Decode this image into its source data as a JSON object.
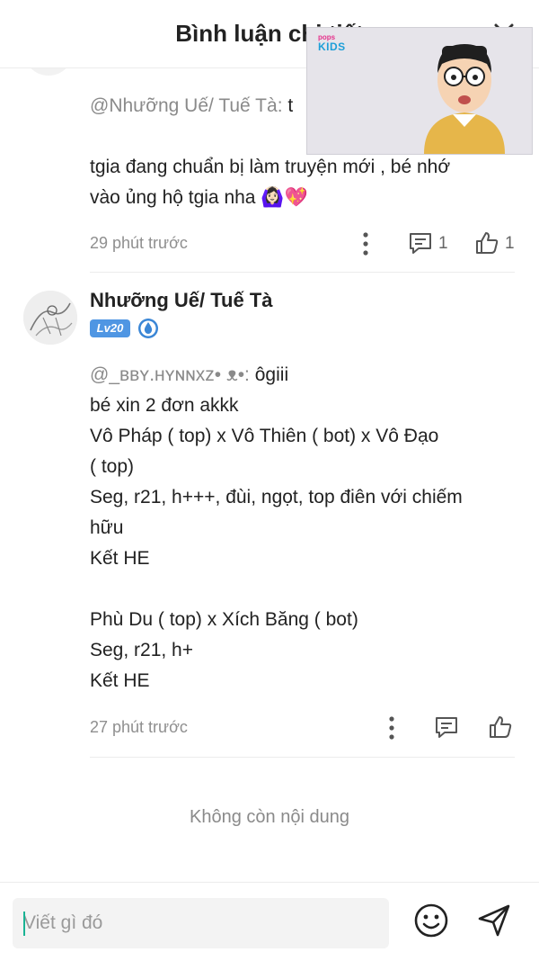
{
  "header": {
    "title": "Bình luận chi tiết"
  },
  "pip": {
    "logo_top": "pops",
    "logo_bottom": "KIDS"
  },
  "comment1": {
    "mention": "@Nhưỡng Uế/ Tuế Tà:",
    "mention_tail": "t",
    "line1": "tgia đang chuẩn bị làm truyện mới , bé nhớ",
    "line2": "vào ủng hộ tgia nha 🙆🏻‍♀️💖",
    "time": "29 phút trước",
    "reply_count": "1",
    "like_count": "1"
  },
  "comment2": {
    "username": "Nhưỡng Uế/ Tuế Tà",
    "level": "Lv20",
    "mention": "@_ʙʙʏ.ʜʏɴɴxᴢ• ᴥ•:",
    "mention_tail": "ôgiii",
    "lines": [
      "bé xin 2 đơn akkk",
      "Vô Pháp ( top) x Vô Thiên ( bot) x Vô Đạo",
      "( top)",
      "Seg, r21, h+++, đùi, ngọt, top điên với chiếm",
      "hữu",
      "Kết HE",
      "",
      "Phù Du ( top) x Xích Băng ( bot)",
      "Seg, r21, h+",
      "Kết HE"
    ],
    "time": "27 phút trước"
  },
  "footer": {
    "no_more": "Không còn nội dung"
  },
  "composer": {
    "placeholder": "Viết gì đó"
  },
  "icons": {
    "close": "close-icon",
    "more": "more-vertical-icon",
    "reply": "comment-icon",
    "like": "thumbs-up-icon",
    "emoji": "smiley-icon",
    "send": "send-icon",
    "badge": "water-drop-icon"
  },
  "colors": {
    "accent": "#19b394",
    "level_badge": "#4f96e3",
    "muted": "#8f8f8f"
  }
}
